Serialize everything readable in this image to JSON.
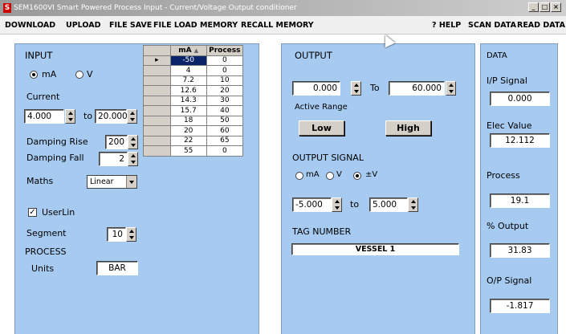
{
  "window": {
    "title": "SEM1600VI Smart Powered Process Input - Current/Voltage Output conditioner",
    "icon_letter": "S"
  },
  "menu": {
    "download": "DOWNLOAD",
    "upload": "UPLOAD",
    "file_save": "FILE SAVE",
    "file_load": "FILE LOAD",
    "memory": "MEMORY",
    "recall_memory": "RECALL MEMORY",
    "help": "? HELP",
    "scan_data": "SCAN DATA",
    "read_data": "READ DATA"
  },
  "input": {
    "heading": "INPUT",
    "radio_ma": "mA",
    "radio_v": "V",
    "selected": "mA",
    "current_label": "Current",
    "current_from": "4.000",
    "to_label": "to",
    "current_to": "20.000",
    "damping_rise_label": "Damping  Rise",
    "damping_rise": "200",
    "damping_fall_label": "Damping  Fall",
    "damping_fall": "2",
    "maths_label": "Maths",
    "maths_value": "Linear",
    "userlin_label": "UserLin",
    "userlin_checked": "✓",
    "segment_label": "Segment",
    "segment_value": "10",
    "process_heading": "PROCESS",
    "units_label": "Units",
    "units_value": "BAR"
  },
  "table": {
    "headers": [
      "mA",
      "Process"
    ],
    "sort_icon": "sort-up-icon",
    "rows": [
      [
        "-50",
        "0"
      ],
      [
        "4",
        "0"
      ],
      [
        "7.2",
        "10"
      ],
      [
        "12.6",
        "20"
      ],
      [
        "14.3",
        "30"
      ],
      [
        "15.7",
        "40"
      ],
      [
        "18",
        "50"
      ],
      [
        "20",
        "60"
      ],
      [
        "22",
        "65"
      ],
      [
        "55",
        "0"
      ]
    ]
  },
  "output": {
    "heading": "OUTPUT",
    "range_from": "0.000",
    "to_label": "To",
    "range_to": "60.000",
    "active_range_label": "Active Range",
    "low_label": "Low",
    "high_label": "High",
    "signal_heading": "OUTPUT SIGNAL",
    "opt_ma": "mA",
    "opt_v": "V",
    "opt_pmv": "±V",
    "selected": "±V",
    "signal_from": "-5.000",
    "signal_to_label": "to",
    "signal_to": "5.000",
    "tag_label": "TAG NUMBER",
    "tag_value": "VESSEL 1"
  },
  "data": {
    "heading": "DATA",
    "ip_signal_label": "I/P Signal",
    "ip_signal": "0.000",
    "elec_value_label": "Elec Value",
    "elec_value": "12.112",
    "process_label": "Process",
    "process": "19.1",
    "output_label": "% Output",
    "output": "31.83",
    "op_signal_label": "O/P Signal",
    "op_signal": "-1.817"
  }
}
